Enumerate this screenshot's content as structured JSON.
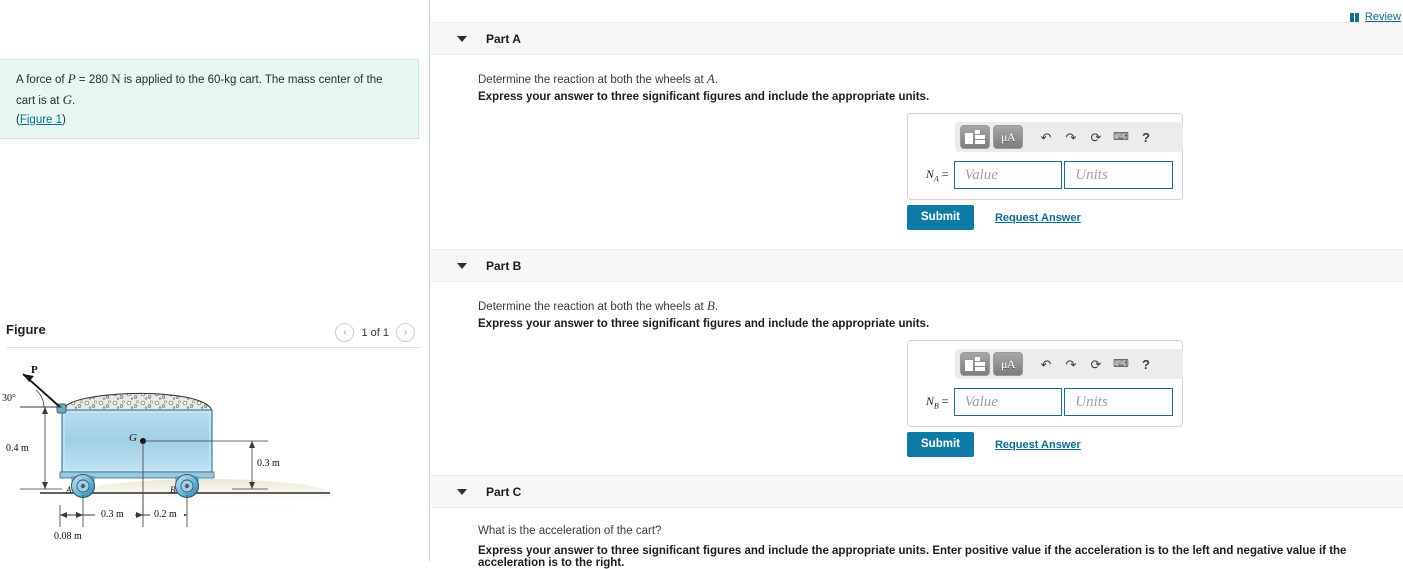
{
  "top_bar": {
    "review_label": "Review",
    "review_icon": "book-icon"
  },
  "left_panel": {
    "problem_statement_prefix": "A force of ",
    "problem_force_symbol": "P",
    "problem_force_value": " = 280 ",
    "problem_force_unit": "N",
    "problem_statement_mid": " is applied to the 60-kg cart. The mass center of the cart is at ",
    "problem_point_symbol": "G",
    "problem_statement_suffix": ".",
    "figure_link_open": "(",
    "figure_link_label": "Figure 1",
    "figure_link_close": ")",
    "figure_title": "Figure",
    "pager_prev": "‹",
    "pager_next": "›",
    "pager_count": "1 of 1",
    "figure_labels": {
      "force": "P",
      "angle": "30°",
      "center": "G",
      "wheel_a": "A",
      "wheel_b": "B",
      "dim_height": "0.4 m",
      "dim_right": "0.3 m",
      "dim_bottom_1": "0.3 m",
      "dim_bottom_2": "0.2 m",
      "dim_offset": "0.08 m"
    }
  },
  "parts": [
    {
      "id": "part-a",
      "label": "Part A",
      "question": "Determine the reaction at both the wheels at ",
      "question_symbol": "A",
      "question_suffix": ".",
      "instruction": "Express your answer to three significant figures and include the appropriate units.",
      "answer_label_base": "N",
      "answer_label_sub": "A",
      "answer_label_eq": " =",
      "value_placeholder": "Value",
      "units_placeholder": "Units",
      "submit_label": "Submit",
      "request_label": "Request Answer"
    },
    {
      "id": "part-b",
      "label": "Part B",
      "question": "Determine the reaction at both the wheels at ",
      "question_symbol": "B",
      "question_suffix": ".",
      "instruction": "Express your answer to three significant figures and include the appropriate units.",
      "answer_label_base": "N",
      "answer_label_sub": "B",
      "answer_label_eq": " =",
      "value_placeholder": "Value",
      "units_placeholder": "Units",
      "submit_label": "Submit",
      "request_label": "Request Answer"
    },
    {
      "id": "part-c",
      "label": "Part C",
      "question": "What is the acceleration of the cart?",
      "instruction": "Express your answer to three significant figures and include the appropriate units. Enter positive value if the acceleration is to the left and negative value if the acceleration is to the right."
    }
  ],
  "math_toolbar": {
    "template_icon": "math-template-icon",
    "units_icon": "greek-units-icon",
    "units_text": "μA",
    "undo_icon": "undo-arrow-icon",
    "undo_glyph": "↶",
    "redo_icon": "redo-arrow-icon",
    "redo_glyph": "↷",
    "reset_icon": "reset-circle-icon",
    "reset_glyph": "⟳",
    "keyboard_icon": "keyboard-icon",
    "keyboard_glyph": "⌨",
    "help_icon": "help-question-icon",
    "help_glyph": "?"
  },
  "colors": {
    "accent": "#0e7ba4",
    "link": "#0b6d8f",
    "statement_bg": "#e6f7f4",
    "part_header_bg": "#f7f7f7",
    "input_border": "#1b6d8a",
    "cart_body": "#a8d4e8"
  }
}
